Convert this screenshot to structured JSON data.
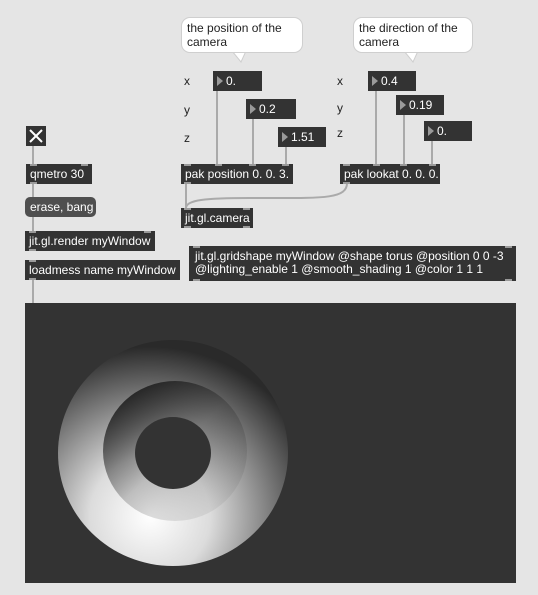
{
  "comments": {
    "camera_position": "the position of the camera",
    "camera_direction": "the direction of the camera"
  },
  "axis_labels": {
    "x1": "x",
    "y1": "y",
    "z1": "z",
    "x2": "x",
    "y2": "y",
    "z2": "z"
  },
  "number_boxes": {
    "pos_x": "0.",
    "pos_y": "0.2",
    "pos_z": "1.51",
    "look_x": "0.4",
    "look_y": "0.19",
    "look_z": "0."
  },
  "objects": {
    "qmetro": "qmetro 30",
    "erase_bang": "erase, bang",
    "render": "jit.gl.render myWindow",
    "loadmess": "loadmess name myWindow",
    "pak_position": "pak position 0. 0. 3.",
    "pak_lookat": "pak lookat 0. 0. 0.",
    "camera": "jit.gl.camera",
    "gridshape_line1": "jit.gl.gridshape myWindow @shape torus @position 0 0 -3",
    "gridshape_line2": "@lighting_enable 1 @smooth_shading 1 @color 1 1 1"
  },
  "icons": {
    "toggle": "close-x-icon"
  },
  "colors": {
    "patch_background": "#e5e5e5",
    "object_box": "#333333",
    "render_background": "#333333"
  }
}
